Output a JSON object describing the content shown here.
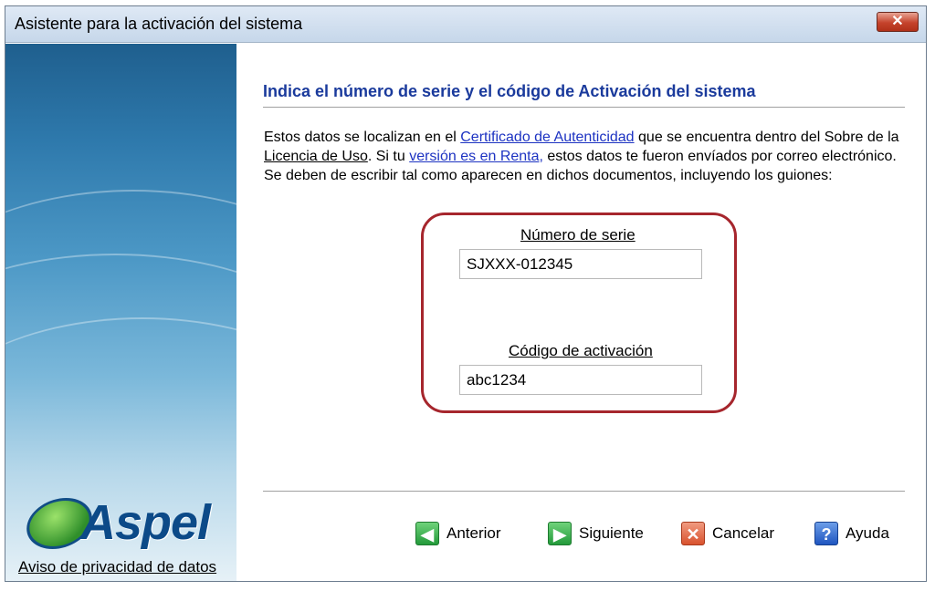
{
  "window": {
    "title": "Asistente para la activación del sistema",
    "close_label": "✕"
  },
  "sidebar": {
    "logo_text": "Aspel",
    "privacy_link": "Aviso de privacidad de datos"
  },
  "main": {
    "heading": "Indica el número de serie y el código de Activación del sistema",
    "paragraph": {
      "t1": "Estos datos se localizan en el ",
      "link1": "Certificado de Autenticidad",
      "t2": " que se encuentra dentro del Sobre de la ",
      "u1": "Licencia de Uso",
      "t3": ". Si tu ",
      "link2": "versión es en Renta,",
      "t4": " estos datos te fueron envíados por correo electrónico. Se deben de escribir tal como aparecen en dichos documentos, incluyendo los guiones:"
    },
    "serial": {
      "label": "Número de serie",
      "value": "SJXXX-012345"
    },
    "activation": {
      "label": "Código de activación",
      "value": "abc1234"
    }
  },
  "buttons": {
    "previous": "Anterior",
    "next": "Siguiente",
    "cancel": "Cancelar",
    "help": "Ayuda"
  },
  "icons": {
    "close": "close-icon",
    "previous": "arrow-left-icon",
    "next": "arrow-right-icon",
    "cancel": "x-icon",
    "help": "question-icon"
  },
  "colors": {
    "heading": "#1a3a9c",
    "highlight": "#a6262d",
    "link": "#1d33c2"
  }
}
